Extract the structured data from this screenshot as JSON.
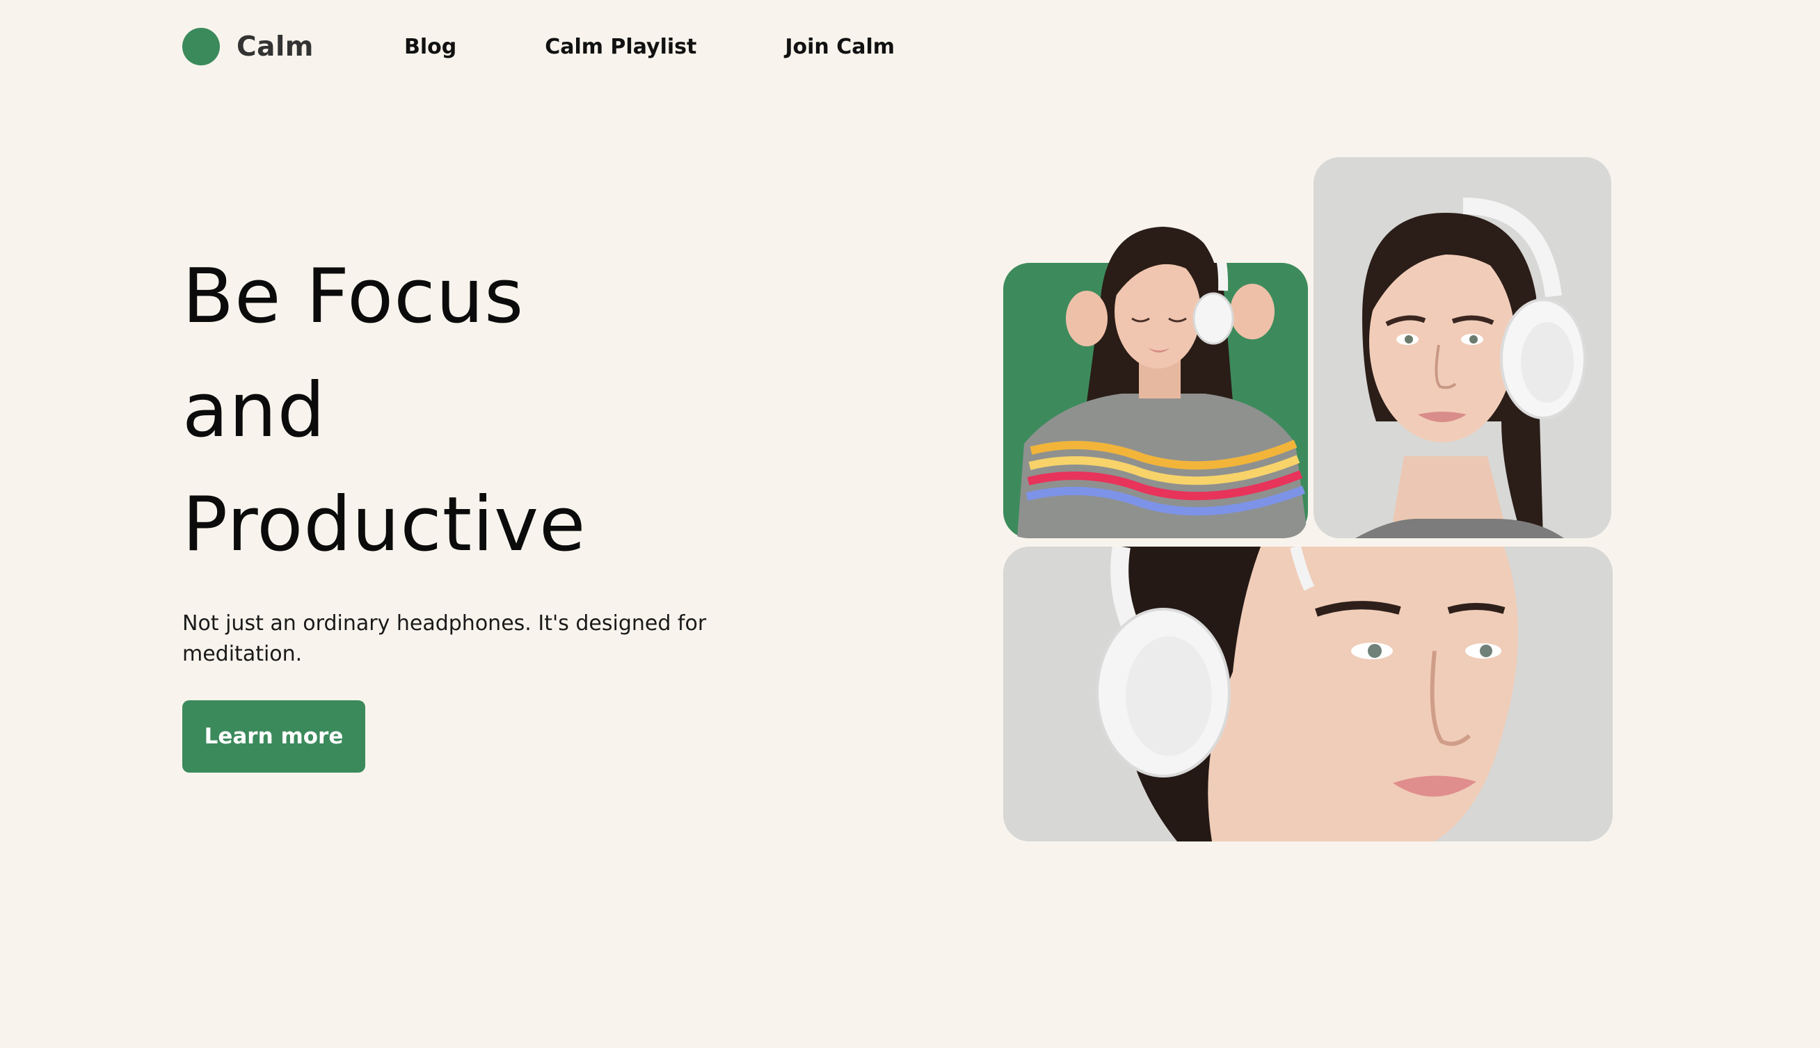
{
  "brand": {
    "name": "Calm",
    "accent_color": "#3b8a5c",
    "background_color": "#f8f4ed"
  },
  "nav": {
    "items": [
      {
        "label": "Blog"
      },
      {
        "label": "Calm Playlist"
      },
      {
        "label": "Join Calm"
      }
    ]
  },
  "hero": {
    "title_lines": [
      "Be Focus",
      "and",
      "Productive"
    ],
    "description": "Not just an ordinary headphones. It's designed for meditation.",
    "cta_label": "Learn more"
  },
  "gallery": {
    "photos": [
      {
        "subject": "woman-in-striped-sweater-wearing-headphones",
        "background": "#3d8b5c"
      },
      {
        "subject": "woman-portrait-with-white-headphones",
        "background": "#d8d8d6"
      },
      {
        "subject": "woman-face-closeup-with-white-headphones",
        "background": "#d7d7d5"
      }
    ]
  }
}
